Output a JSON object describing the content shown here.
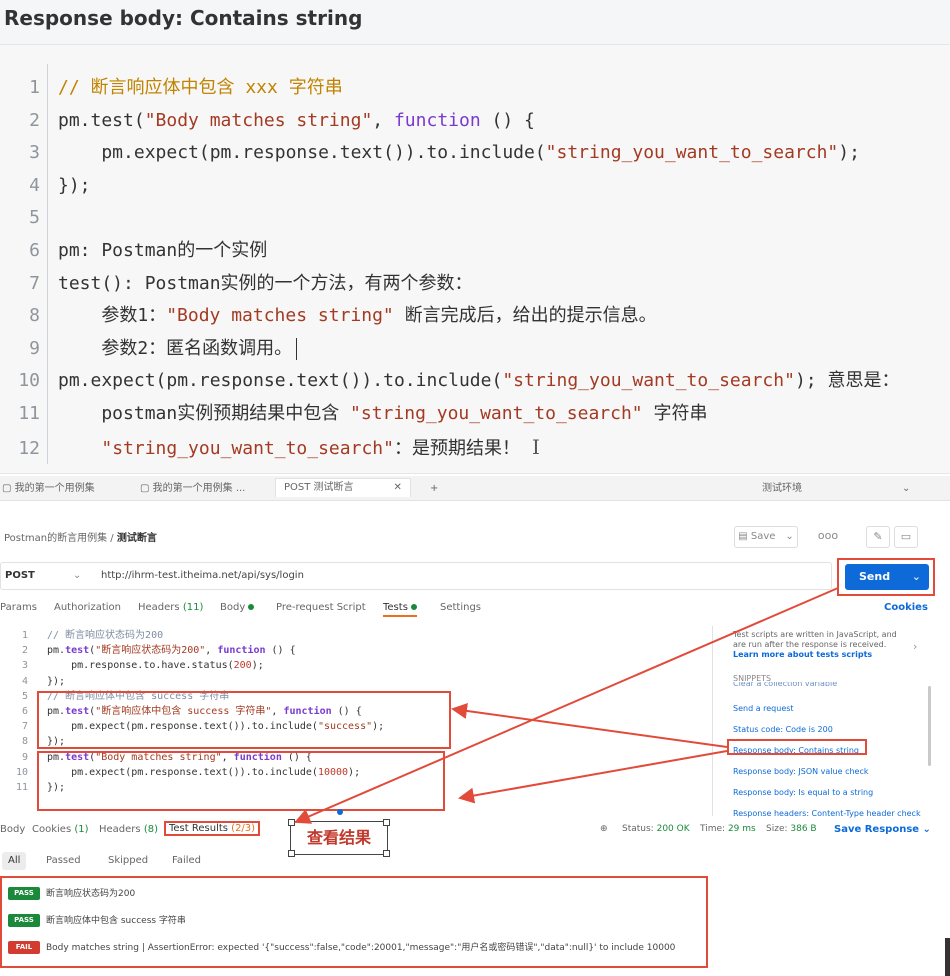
{
  "note": {
    "title": "Response body: Contains string",
    "lines": [
      {
        "n": "1",
        "parts": [
          {
            "t": "// 断言响应体中包含 xxx 字符串",
            "c": "cmt"
          }
        ]
      },
      {
        "n": "2",
        "parts": [
          {
            "t": "pm.test(",
            "c": ""
          },
          {
            "t": "\"Body matches string\"",
            "c": "str"
          },
          {
            "t": ", ",
            "c": ""
          },
          {
            "t": "function",
            "c": "kw"
          },
          {
            "t": " () {",
            "c": ""
          }
        ]
      },
      {
        "n": "3",
        "parts": [
          {
            "t": "    pm.expect(pm.response.text()).to.include(",
            "c": ""
          },
          {
            "t": "\"string_you_want_to_search\"",
            "c": "str"
          },
          {
            "t": ");",
            "c": ""
          }
        ]
      },
      {
        "n": "4",
        "parts": [
          {
            "t": "});",
            "c": ""
          }
        ]
      },
      {
        "n": "5",
        "parts": [
          {
            "t": "",
            "c": ""
          }
        ]
      },
      {
        "n": "6",
        "parts": [
          {
            "t": "pm: Postman的一个实例",
            "c": ""
          }
        ]
      },
      {
        "n": "7",
        "parts": [
          {
            "t": "test(): Postman实例的一个方法，有两个参数：",
            "c": ""
          }
        ]
      },
      {
        "n": "8",
        "parts": [
          {
            "t": "    参数1：",
            "c": ""
          },
          {
            "t": "\"Body matches string\"",
            "c": "str"
          },
          {
            "t": " 断言完成后，给出的提示信息。",
            "c": ""
          }
        ]
      },
      {
        "n": "9",
        "parts": [
          {
            "t": "    参数2：匿名函数调用。",
            "c": ""
          }
        ]
      },
      {
        "n": "10",
        "parts": [
          {
            "t": "pm.expect(pm.response.text()).to.include(",
            "c": ""
          },
          {
            "t": "\"string_you_want_to_search\"",
            "c": "str"
          },
          {
            "t": "); 意思是：",
            "c": ""
          }
        ]
      },
      {
        "n": "11",
        "parts": [
          {
            "t": "    postman实例预期结果中包含 ",
            "c": ""
          },
          {
            "t": "\"string_you_want_to_search\"",
            "c": "str"
          },
          {
            "t": " 字符串",
            "c": ""
          }
        ]
      },
      {
        "n": "12",
        "parts": [
          {
            "t": "    ",
            "c": ""
          },
          {
            "t": "\"string_you_want_to_search\"",
            "c": "str"
          },
          {
            "t": "：是预期结果！",
            "c": ""
          }
        ]
      }
    ]
  },
  "app": {
    "tabs": [
      "我的第一个用例集",
      "我的第一个用例集 ...",
      "POST 测试断言",
      "测试环境"
    ],
    "breadcrumb_parent": "Postman的断言用例集 /",
    "breadcrumb_current": "测试断言",
    "save_label": "Save",
    "method": "POST",
    "url": "http://ihrm-test.itheima.net/api/sys/login",
    "send_label": "Send",
    "req_tabs": {
      "params": "Params",
      "authorization": "Authorization",
      "headers": "Headers",
      "headers_count": "(11)",
      "body": "Body",
      "prerequest": "Pre-request Script",
      "tests": "Tests",
      "settings": "Settings"
    },
    "cookies": "Cookies",
    "editor_lines": [
      {
        "n": "1",
        "parts": [
          {
            "t": "// 断言响应状态码为200",
            "c": "cmt"
          }
        ]
      },
      {
        "n": "2",
        "parts": [
          {
            "t": "pm.",
            "c": ""
          },
          {
            "t": "test",
            "c": "kw"
          },
          {
            "t": "(",
            "c": ""
          },
          {
            "t": "\"断言响应状态码为200\"",
            "c": "str"
          },
          {
            "t": ", ",
            "c": ""
          },
          {
            "t": "function",
            "c": "kw"
          },
          {
            "t": " () {",
            "c": ""
          }
        ]
      },
      {
        "n": "3",
        "parts": [
          {
            "t": "    pm.response.to.have.status(",
            "c": ""
          },
          {
            "t": "200",
            "c": "num"
          },
          {
            "t": ");",
            "c": ""
          }
        ]
      },
      {
        "n": "4",
        "parts": [
          {
            "t": "});",
            "c": ""
          }
        ]
      },
      {
        "n": "5",
        "parts": [
          {
            "t": "// 断言响应体中包含 success 字符串",
            "c": "cmt"
          }
        ]
      },
      {
        "n": "6",
        "parts": [
          {
            "t": "pm.",
            "c": ""
          },
          {
            "t": "test",
            "c": "kw"
          },
          {
            "t": "(",
            "c": ""
          },
          {
            "t": "\"断言响应体中包含 success 字符串\"",
            "c": "str"
          },
          {
            "t": ", ",
            "c": ""
          },
          {
            "t": "function",
            "c": "kw"
          },
          {
            "t": " () {",
            "c": ""
          }
        ]
      },
      {
        "n": "7",
        "parts": [
          {
            "t": "    pm.expect(pm.response.text()).to.include(",
            "c": ""
          },
          {
            "t": "\"success\"",
            "c": "str"
          },
          {
            "t": ");",
            "c": ""
          }
        ]
      },
      {
        "n": "8",
        "parts": [
          {
            "t": "});",
            "c": ""
          }
        ]
      },
      {
        "n": "9",
        "parts": [
          {
            "t": "pm.",
            "c": ""
          },
          {
            "t": "test",
            "c": "kw"
          },
          {
            "t": "(",
            "c": ""
          },
          {
            "t": "\"Body matches string\"",
            "c": "str"
          },
          {
            "t": ", ",
            "c": ""
          },
          {
            "t": "function",
            "c": "kw"
          },
          {
            "t": " () {",
            "c": ""
          }
        ]
      },
      {
        "n": "10",
        "parts": [
          {
            "t": "    pm.expect(pm.response.text()).to.include(",
            "c": ""
          },
          {
            "t": "10000",
            "c": "num"
          },
          {
            "t": ");",
            "c": ""
          }
        ]
      },
      {
        "n": "11",
        "parts": [
          {
            "t": "});",
            "c": ""
          }
        ]
      }
    ],
    "side": {
      "info": "Test scripts are written in JavaScript, and are run after the response is received.",
      "learn": "Learn more about tests scripts",
      "snippets_label": "SNIPPETS",
      "partial_item": "Clear a collection variable",
      "items": [
        "Send a request",
        "Status code: Code is 200",
        "Response body: Contains string",
        "Response body: JSON value check",
        "Response body: Is equal to a string",
        "Response headers: Content-Type header check"
      ]
    },
    "resp_tabs": {
      "body": "Body",
      "cookies": "Cookies",
      "cookies_count": "(1)",
      "headers": "Headers",
      "headers_count": "(8)",
      "test_results": "Test Results",
      "test_results_count": "(2/3)"
    },
    "status": {
      "status_label": "Status:",
      "status_value": "200 OK",
      "time_label": "Time:",
      "time_value": "29 ms",
      "size_label": "Size:",
      "size_value": "386 B"
    },
    "save_response": "Save Response",
    "filters": [
      "All",
      "Passed",
      "Skipped",
      "Failed"
    ],
    "annotation": "查看结果",
    "results": [
      {
        "badge": "PASS",
        "text": "断言响应状态码为200"
      },
      {
        "badge": "PASS",
        "text": "断言响应体中包含 success 字符串"
      },
      {
        "badge": "FAIL",
        "text": "Body matches string | AssertionError: expected '{\"success\":false,\"code\":20001,\"message\":\"用户名或密码错误\",\"data\":null}' to include 10000"
      }
    ]
  },
  "colors": {
    "accent": "#0d6ad8",
    "annotation_red": "#e24a3a",
    "pass": "#1a8a3a",
    "fail": "#d23c30"
  }
}
